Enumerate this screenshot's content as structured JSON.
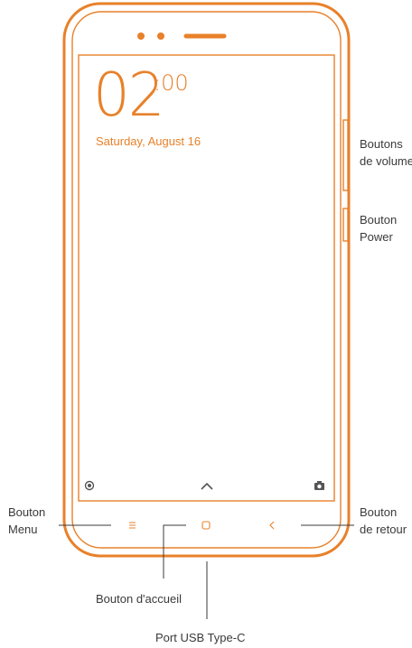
{
  "screen": {
    "time_hours": "02",
    "time_minutes": ":00",
    "date": "Saturday, August 16"
  },
  "labels": {
    "volume": [
      "Boutons",
      "de volume"
    ],
    "power": [
      "Bouton",
      "Power"
    ],
    "menu": [
      "Bouton",
      "Menu"
    ],
    "back": [
      "Bouton",
      "de retour"
    ],
    "home": "Bouton d'accueil",
    "usb": "Port USB Type-C"
  },
  "icons": {
    "camera_left": "circle-dot-icon",
    "swipe_up": "chevron-up-icon",
    "camera_right": "camera-icon",
    "menu": "hamburger-menu-icon",
    "home": "home-square-icon",
    "back": "chevron-left-icon"
  },
  "colors": {
    "accent": "#e8812a",
    "text": "#3a3a3a",
    "line": "#3a3a3a"
  }
}
